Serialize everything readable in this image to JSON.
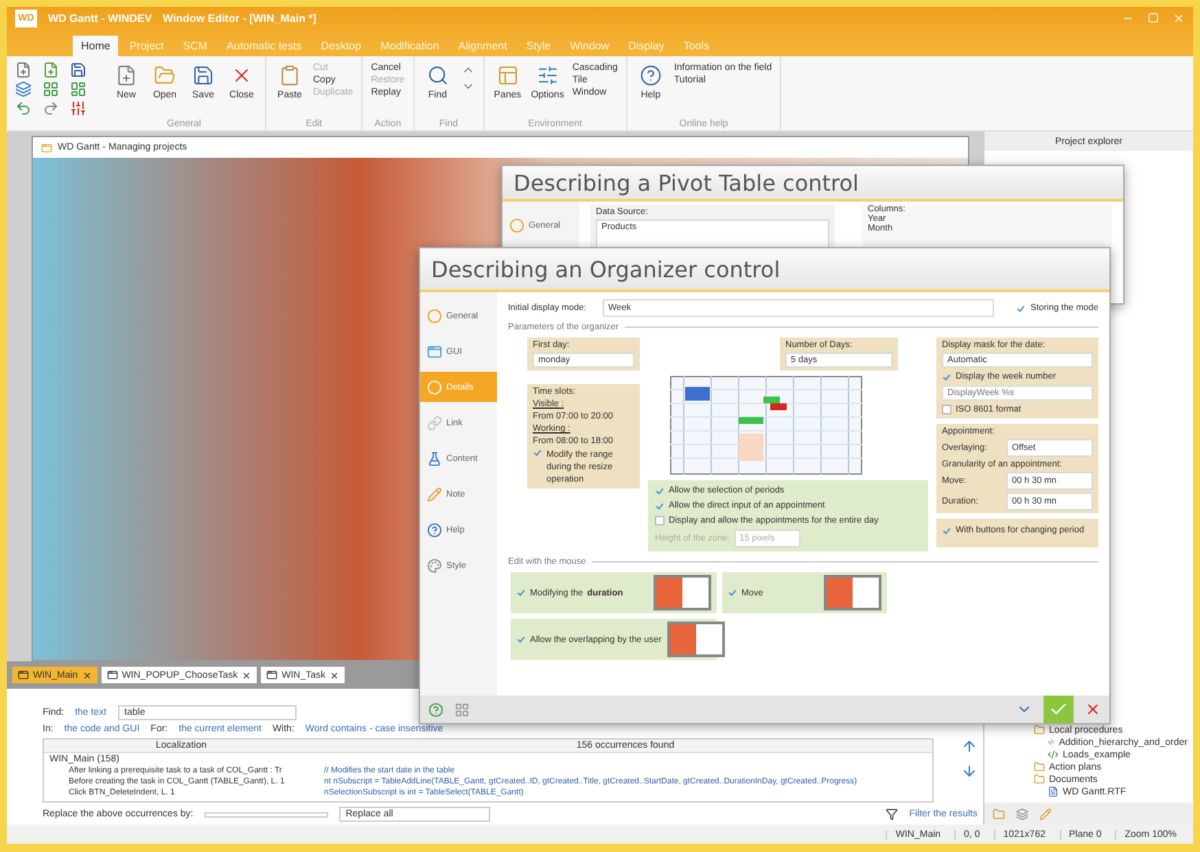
{
  "window": {
    "logo": "WD",
    "title": "WD Gantt - WINDEV",
    "subtitle": "Window Editor - [WIN_Main *]"
  },
  "ribbon_tabs": [
    {
      "label": "Home",
      "selected": true
    },
    {
      "label": "Project",
      "selected": false
    },
    {
      "label": "SCM",
      "selected": false
    },
    {
      "label": "Automatic tests",
      "selected": false
    },
    {
      "label": "Desktop",
      "selected": false
    },
    {
      "label": "Modification",
      "selected": false
    },
    {
      "label": "Alignment",
      "selected": false
    },
    {
      "label": "Style",
      "selected": false
    },
    {
      "label": "Window",
      "selected": false
    },
    {
      "label": "Display",
      "selected": false
    },
    {
      "label": "Tools",
      "selected": false
    }
  ],
  "ribbon_groups": [
    {
      "name": "General",
      "buttons": [
        {
          "label": "New",
          "kind": "new"
        },
        {
          "label": "Open",
          "kind": "open"
        },
        {
          "label": "Save",
          "kind": "save"
        },
        {
          "label": "Close",
          "kind": "close"
        }
      ]
    },
    {
      "name": "Edit",
      "buttons": [
        {
          "label": "Paste",
          "kind": "paste"
        }
      ],
      "small": [
        {
          "label": "Cut",
          "disabled": true
        },
        {
          "label": "Copy",
          "disabled": false
        },
        {
          "label": "Duplicate",
          "disabled": true
        }
      ]
    },
    {
      "name": "Action",
      "small": [
        {
          "label": "Cancel",
          "disabled": false
        },
        {
          "label": "Restore",
          "disabled": true
        },
        {
          "label": "Replay",
          "disabled": false
        }
      ]
    },
    {
      "name": "Find",
      "buttons": [
        {
          "label": "Find",
          "kind": "find"
        }
      ]
    },
    {
      "name": "Environment",
      "buttons": [
        {
          "label": "Panes",
          "kind": "panes"
        },
        {
          "label": "Options",
          "kind": "options"
        }
      ],
      "small": [
        {
          "label": "Cascading",
          "disabled": false
        },
        {
          "label": "Tile",
          "disabled": false
        },
        {
          "label": "Window",
          "disabled": false
        }
      ]
    },
    {
      "name": "Online help",
      "buttons": [
        {
          "label": "Help",
          "kind": "help"
        }
      ],
      "small": [
        {
          "label": "Information on the field",
          "disabled": false
        },
        {
          "label": "Tutorial",
          "disabled": false
        }
      ]
    }
  ],
  "editor_window": {
    "title": "WD Gantt - Managing projects"
  },
  "pivot_dialog": {
    "title": "Describing a Pivot Table control",
    "nav": [
      {
        "label": "General",
        "selected": false
      }
    ],
    "data_source_label": "Data Source:",
    "data_source": "Products",
    "columns_label": "Columns:",
    "columns": [
      "Year",
      "Month"
    ]
  },
  "organizer_dialog": {
    "title": "Describing an Organizer control",
    "nav": [
      {
        "label": "General",
        "selected": false
      },
      {
        "label": "GUI",
        "selected": false
      },
      {
        "label": "Details",
        "selected": true
      },
      {
        "label": "Link",
        "selected": false
      },
      {
        "label": "Content",
        "selected": false
      },
      {
        "label": "Note",
        "selected": false
      },
      {
        "label": "Help",
        "selected": false
      },
      {
        "label": "Style",
        "selected": false
      }
    ],
    "initial_display_label": "Initial display mode:",
    "initial_display": "Week",
    "storing": {
      "label": "Storing the mode",
      "checked": true
    },
    "parameters_title": "Parameters of the organizer",
    "first_day_label": "First day:",
    "first_day": "monday",
    "days_label": "Number of Days:",
    "days": "5 days",
    "time_slots_label": "Time slots:",
    "visible_label": "Visible :",
    "visible_range": "From 07:00 to 20:00",
    "working_label": "Working :",
    "working_range": "From 08:00 to 18:00",
    "modify_range": {
      "label": "Modify the range during the resize operation",
      "checked": true
    },
    "date_mask_label": "Display mask for the date:",
    "date_mask": "Automatic",
    "week_number": {
      "label": "Display the week number",
      "checked": true
    },
    "week_mask_placeholder": "DisplayWeek %s",
    "iso": {
      "label": "ISO 8601 format",
      "checked": false
    },
    "appointment_label": "Appointment:",
    "overlaying_label": "Overlaying:",
    "overlaying": "Offset",
    "granularity_label": "Granularity of an appointment:",
    "move_label": "Move:",
    "move": "00 h 30 mn",
    "duration_label": "Duration:",
    "duration": "00 h 30 mn",
    "options": [
      {
        "label": "Allow the selection of periods",
        "checked": true
      },
      {
        "label": "Allow the direct input of an appointment",
        "checked": true
      },
      {
        "label": "Display and allow the appointments for the entire day",
        "checked": false
      }
    ],
    "height_label": "Height of the zone:",
    "height": "15 pixels",
    "period_buttons": {
      "label": "With buttons for changing period",
      "checked": true
    },
    "mouse_title": "Edit with the mouse",
    "mouse_options": [
      {
        "label": "Modifying the **duration**",
        "checked": true
      },
      {
        "label": "Move",
        "checked": true
      },
      {
        "label": "Allow the overlapping by the user",
        "checked": true
      }
    ]
  },
  "doc_tabs": [
    {
      "label": "WIN_Main",
      "selected": true
    },
    {
      "label": "WIN_POPUP_ChooseTask",
      "selected": false
    },
    {
      "label": "WIN_Task",
      "selected": false
    }
  ],
  "find_panel": {
    "find_label": "Find:",
    "find_scope": "the text",
    "find_value": "table",
    "in_label": "In:",
    "in_value": "the code and GUI",
    "for_label": "For:",
    "for_value": "the current element",
    "with_label": "With:",
    "with_value": "Word contains - case insensitive",
    "columns": [
      "Localization",
      "156 occurrences found"
    ],
    "group": "WIN_Main (158)",
    "rows": [
      {
        "location": "After linking a prerequisite task to a task of COL_Gantt : Tr",
        "code": "// Modifies the start date in the table"
      },
      {
        "location": "Before creating the task in COL_Gantt (TABLE_Gantt), L. 1",
        "code": "nt nSubscript = TableAddLine(TABLE_Gantt, gtCreated..ID, gtCreated..Title, gtCreated..StartDate, gtCreated..DurationInDay, gtCreated..Progress)"
      },
      {
        "location": "Click BTN_DeleteIndent, L. 1",
        "code": "nSelectionSubscript is int = TableSelect(TABLE_Gantt)"
      }
    ],
    "replace_label": "Replace the above occurrences by:",
    "replace_all": "Replace all",
    "filter": "Filter the results"
  },
  "explorer": {
    "title": "Project explorer",
    "tree": [
      {
        "label": "Local procedures",
        "kind": "folder",
        "children": [
          {
            "label": "Addition_hierarchy_and_order",
            "kind": "procedure"
          },
          {
            "label": "Loads_example",
            "kind": "procedure"
          }
        ]
      },
      {
        "label": "Action plans",
        "kind": "folder"
      },
      {
        "label": "Documents",
        "kind": "folder",
        "children": [
          {
            "label": "WD Gantt.RTF",
            "kind": "document"
          }
        ]
      }
    ]
  },
  "status_bar": [
    "WIN_Main",
    "0, 0",
    "1021x762",
    "Plane 0",
    "Zoom 100%"
  ]
}
